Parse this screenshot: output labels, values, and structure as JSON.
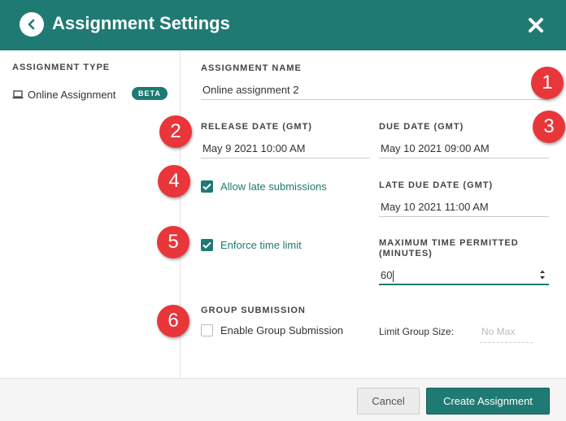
{
  "header": {
    "title": "Assignment Settings",
    "back_icon": "chevron-left-icon",
    "close_icon": "close-icon"
  },
  "sidebar": {
    "heading": "ASSIGNMENT TYPE",
    "items": [
      {
        "label": "Online Assignment",
        "badge": "BETA",
        "icon": "laptop-icon"
      }
    ]
  },
  "form": {
    "assignment_name": {
      "label": "ASSIGNMENT NAME",
      "value": "Online assignment 2"
    },
    "release_date": {
      "label": "RELEASE DATE (GMT)",
      "value": "May 9 2021 10:00 AM"
    },
    "due_date": {
      "label": "DUE DATE (GMT)",
      "value": "May 10 2021 09:00 AM"
    },
    "allow_late": {
      "label": "Allow late submissions",
      "checked": true
    },
    "late_due_date": {
      "label": "LATE DUE DATE (GMT)",
      "value": "May 10 2021 11:00 AM"
    },
    "enforce_time": {
      "label": "Enforce time limit",
      "checked": true
    },
    "max_time": {
      "label": "MAXIMUM TIME PERMITTED (MINUTES)",
      "value": "60"
    },
    "group": {
      "heading": "GROUP SUBMISSION",
      "enable_label": "Enable Group Submission",
      "enable_checked": false,
      "limit_label": "Limit Group Size:",
      "limit_placeholder": "No Max"
    }
  },
  "annotations": [
    "1",
    "2",
    "3",
    "4",
    "5",
    "6"
  ],
  "footer": {
    "cancel_label": "Cancel",
    "create_label": "Create Assignment"
  },
  "colors": {
    "accent": "#1f7a73",
    "badge_red": "#e8363a"
  }
}
